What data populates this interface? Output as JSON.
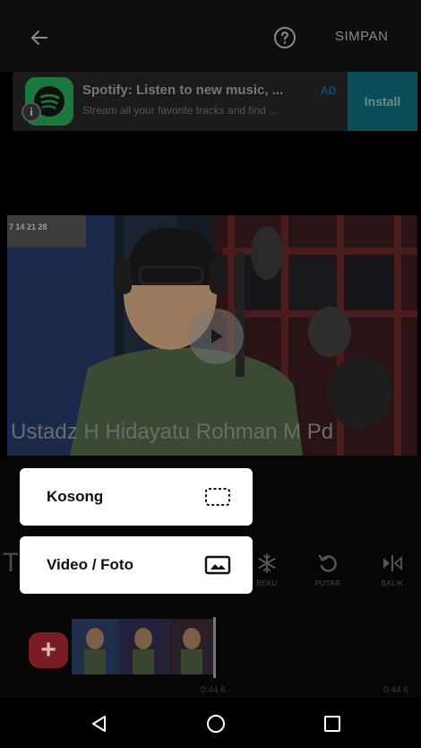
{
  "topbar": {
    "save_label": "SIMPAN"
  },
  "ad": {
    "title": "Spotify: Listen to new music, ...",
    "badge": "AD",
    "subtitle": "Stream all your favorite tracks and find ...",
    "install_label": "Install",
    "info_glyph": "i"
  },
  "video": {
    "overlay_text": "Ustadz H Hidayatu Rohman M Pd",
    "calendar_text": "7 14 21 28"
  },
  "tools": [
    {
      "label": "",
      "glyph": "T"
    },
    {
      "label": "BEKU",
      "glyph": "snowflake-icon"
    },
    {
      "label": "PUTAR",
      "glyph": "rotate-icon"
    },
    {
      "label": "BALIK",
      "glyph": "flip-icon"
    }
  ],
  "menu": {
    "empty_label": "Kosong",
    "media_label": "Video / Foto"
  },
  "timeline": {
    "time_mid": "0:44.6",
    "time_end": "0:44.6",
    "add_glyph": "+"
  },
  "colors": {
    "accent_teal": "#0b4e57",
    "add_red": "#7a1d22",
    "ad_badge_blue": "#0d4d7a"
  }
}
